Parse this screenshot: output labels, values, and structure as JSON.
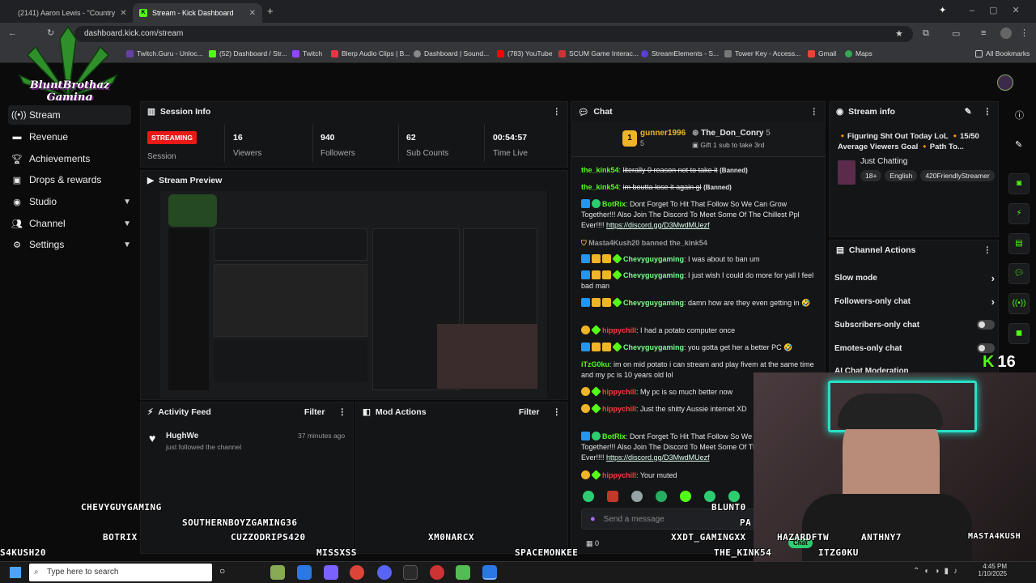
{
  "browser": {
    "tabs": [
      {
        "title": "(2141) Aaron Lewis - \"Country",
        "active": false
      },
      {
        "title": "Stream - Kick Dashboard",
        "active": true
      }
    ],
    "url": "dashboard.kick.com/stream",
    "bookmarks": [
      "Twitch.Guru - Unloc...",
      "(52) Dashboard / Str...",
      "Twitch",
      "Blerp Audio Clips | B...",
      "Dashboard | Sound...",
      "(783) YouTube",
      "SCUM Game Interac...",
      "StreamElements - S...",
      "Tower Key - Access...",
      "Gmail",
      "Maps",
      "All Bookmarks"
    ]
  },
  "logo": {
    "text": "BluntBrothaz Gaming"
  },
  "sidebar": {
    "items": [
      {
        "label": "Stream",
        "icon": "broadcast-icon"
      },
      {
        "label": "Revenue",
        "icon": "money-icon"
      },
      {
        "label": "Achievements",
        "icon": "trophy-icon"
      },
      {
        "label": "Drops & rewards",
        "icon": "gift-icon"
      },
      {
        "label": "Studio",
        "icon": "gamepad-icon"
      },
      {
        "label": "Channel",
        "icon": "people-icon"
      },
      {
        "label": "Settings",
        "icon": "gear-icon"
      }
    ]
  },
  "session": {
    "title": "Session Info",
    "status": "STREAMING",
    "status_label": "Session",
    "stats": [
      {
        "value": "16",
        "label": "Viewers"
      },
      {
        "value": "940",
        "label": "Followers"
      },
      {
        "value": "62",
        "label": "Sub Counts"
      },
      {
        "value": "00:54:57",
        "label": "Time Live"
      }
    ]
  },
  "preview": {
    "title": "Stream Preview"
  },
  "activity": {
    "title": "Activity Feed",
    "filter": "Filter",
    "items": [
      {
        "user": "HughWe",
        "text": "just followed the channel",
        "time": "37 minutes ago"
      }
    ]
  },
  "mod_actions": {
    "title": "Mod Actions",
    "filter": "Filter"
  },
  "chat": {
    "title": "Chat",
    "pinned": {
      "rank": "1",
      "user1": "gunner1996",
      "count1": "5",
      "user2": "The_Don_Conry",
      "count2": "5",
      "note": "Gift 1 sub to take 3rd"
    },
    "messages": [
      {
        "user": "the_kink54",
        "text": "literally 0 reason not to take it",
        "tag": "(Banned)"
      },
      {
        "user": "the_kink54",
        "text": "im boutta lose it again gl",
        "tag": "(Banned)"
      },
      {
        "user": "BotRix",
        "text": "Dont Forget To Hit That Follow So We Can Grow Together!!! Also Join The Discord To Meet Some Of The Chillest Ppl Ever!!!!",
        "link": "https://discord.gg/D3MwdMUezf"
      },
      {
        "system": "Masta4Kush20 banned the_kink54"
      },
      {
        "user": "Chevyguygaming",
        "text": "I was about to ban um"
      },
      {
        "user": "Chevyguygaming",
        "text": "I just wish I could do more for yall I feel bad man"
      },
      {
        "user": "Chevyguygaming",
        "text": "damn how are they even getting in 🤣"
      },
      {
        "user": "hippychill",
        "text": "I had a potato computer once"
      },
      {
        "user": "Chevyguygaming",
        "text": "you gotta get her a better PC 🤣"
      },
      {
        "user": "iTzG0ku",
        "text": "im on mid potato i can stream and play fivem at the same time and my pc is 10 years old lol"
      },
      {
        "user": "hippychill",
        "text": "My pc is so much better now"
      },
      {
        "user": "hippychill",
        "text": "Just the shitty Aussie internet XD"
      },
      {
        "user": "BotRix",
        "text": "Dont Forget To Hit That Follow So We Can Grow Together!!! Also Join The Discord To Meet Some Of The Chillest Ppl Ever!!!!",
        "link": "https://discord.gg/D3MwdMUezf"
      },
      {
        "user": "hippychill",
        "text": "Your muted"
      }
    ],
    "input_placeholder": "Send a message",
    "points": "0",
    "chat_button": "Chat"
  },
  "stream_info": {
    "title": "Stream info",
    "stream_title": "🔸Figuring Sht Out Today LoL 🔸15/50 Average Viewers Goal 🔸Path To...",
    "category": "Just Chatting",
    "tags": [
      "18+",
      "English",
      "420FriendlyStreamer"
    ]
  },
  "channel_actions": {
    "title": "Channel Actions",
    "items": [
      "Slow mode",
      "Followers-only chat",
      "Subscribers-only chat",
      "Emotes-only chat",
      "AI Chat Moderation"
    ]
  },
  "overlay": {
    "viewer_count": "16",
    "credits": [
      "CHEVYGUYGAMING",
      "SOUTHERNBOYZGAMING36",
      "BOTRIX",
      "CUZZODRIPS420",
      "XM0NARCX",
      "S4KUSH20",
      "MISSXSS",
      "SPACEMONKEE",
      "THE_KINK54",
      "ITZG0KU",
      "XXDT_GAMINGXX",
      "HAZARDFTW",
      "ANTHNY7",
      "MASTA4KUSH",
      "BLUNT0",
      "PA"
    ]
  },
  "taskbar": {
    "search": "Type here to search",
    "time": "4:45 PM",
    "date": "1/10/2025"
  },
  "colors": {
    "kick_green": "#53fc18",
    "streaming_red": "#e91916",
    "panel_bg": "#141517"
  }
}
